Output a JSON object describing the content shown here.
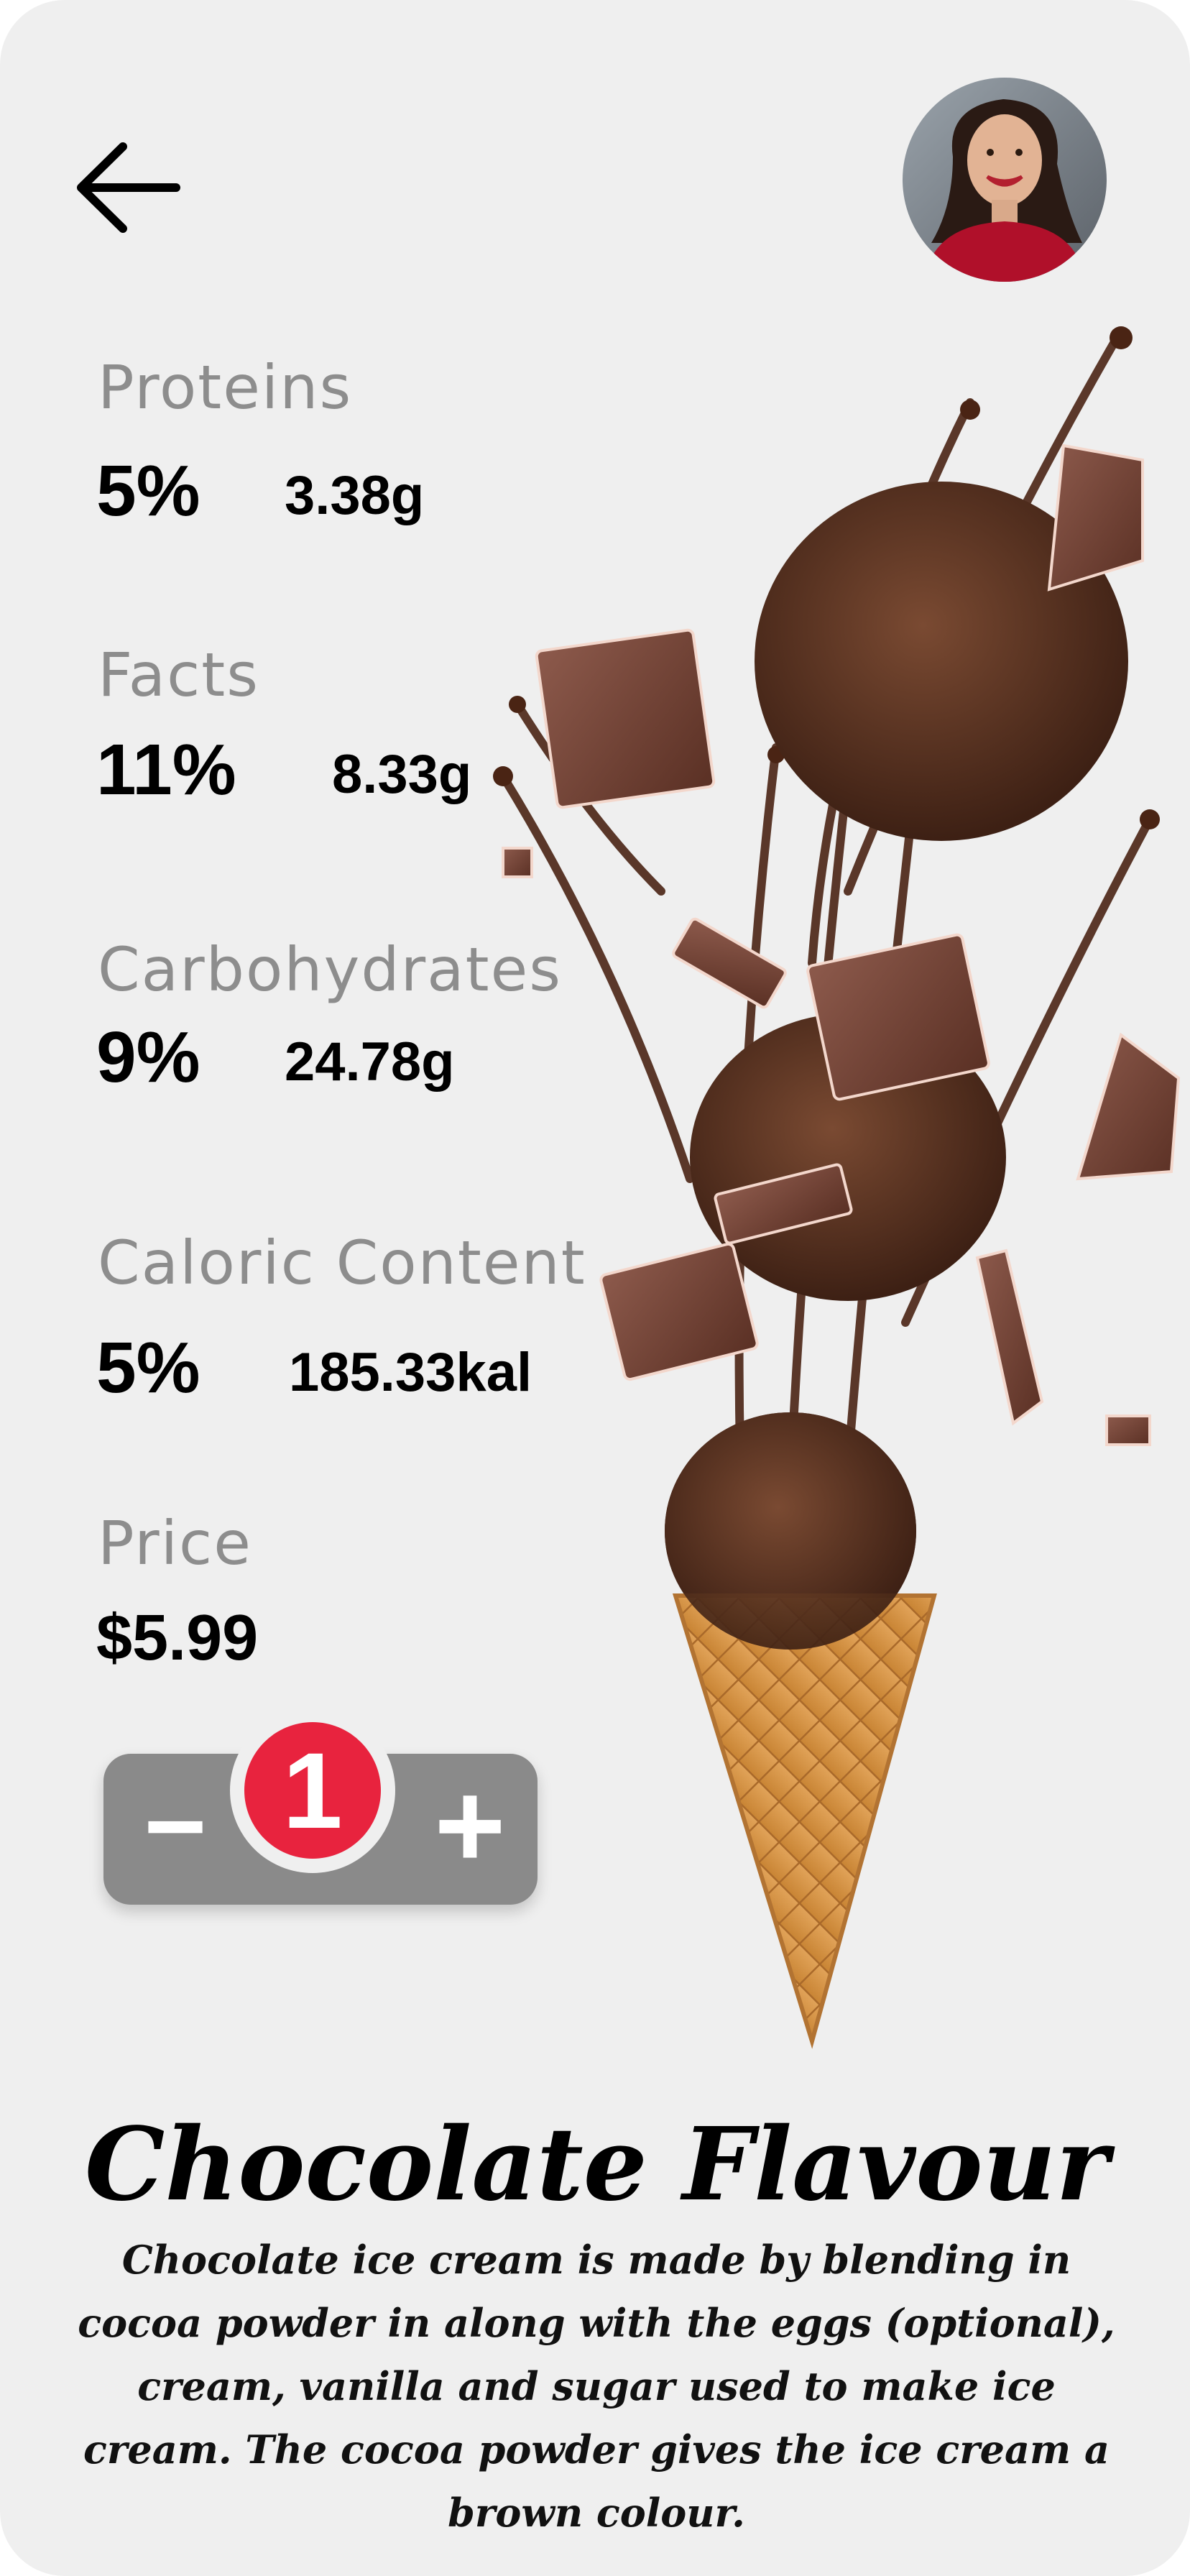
{
  "nutrients": [
    {
      "label": "Proteins",
      "percent": "5%",
      "amount": "3.38g"
    },
    {
      "label": "Facts",
      "percent": "11%",
      "amount": "8.33g"
    },
    {
      "label": "Carbohydrates",
      "percent": "9%",
      "amount": "24.78g"
    },
    {
      "label": "Caloric Content",
      "percent": "5%",
      "amount": "185.33kal"
    }
  ],
  "price": {
    "label": "Price",
    "value": "$5.99"
  },
  "stepper": {
    "minus": "−",
    "plus": "+",
    "quantity": "1"
  },
  "product": {
    "title": "Chocolate Flavour",
    "description": "Chocolate ice cream is made by blending in cocoa powder in along with the eggs (optional), cream, vanilla and sugar used to make ice cream. The cocoa powder gives the ice cream a brown colour."
  },
  "icons": {
    "back": "arrow-left-icon",
    "avatar": "user-avatar",
    "hero": "ice-cream-cone-illustration"
  },
  "colors": {
    "background": "#efefef",
    "badge": "#e8233e",
    "stepper": "#8a8a8a",
    "label": "#8d8d8d"
  }
}
